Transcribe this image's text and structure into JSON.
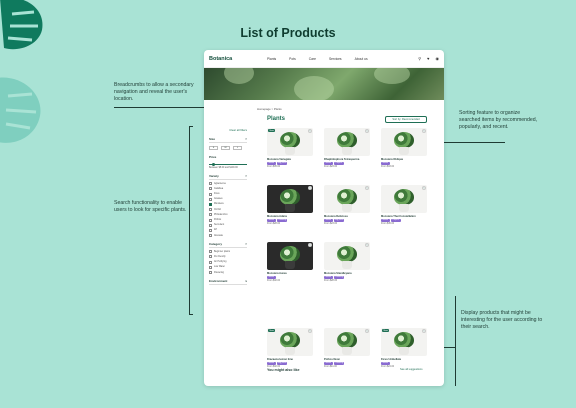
{
  "page_title": "List of Products",
  "annotations": {
    "breadcrumbs": "Breadcrumbs to allow a secondary navigation and reveal the user's location.",
    "search": "Search functionality to enable users to look for specific plants.",
    "sorting": "Sorting feature to organize searched items by recommended, popularly, and recent.",
    "display": "Display products that might be interesting for the user according to their search."
  },
  "navbar": {
    "logo": "Botanica",
    "menu": [
      "Plants",
      "Pots",
      "Care",
      "Services",
      "About us"
    ],
    "icons": [
      "search-icon",
      "heart-icon",
      "cart-icon"
    ]
  },
  "breadcrumb": {
    "home": "Homepage",
    "current": "Plants"
  },
  "main": {
    "title": "Plants",
    "sort_label": "Sort by: Recommended"
  },
  "sidebar": {
    "clear_label": "Clear all filters",
    "size": {
      "label": "Size",
      "options": [
        "S",
        "M",
        "L"
      ]
    },
    "price": {
      "label": "Price",
      "range": "Between $5.00 and $100.00"
    },
    "variety": {
      "label": "Variety",
      "items": [
        "Aglaonema",
        "Calathea",
        "Ficus",
        "Grasses",
        "Monstera",
        "Orchid",
        "Philodendron",
        "Pothos",
        "Succulent",
        "ZZ",
        "Alocasia"
      ],
      "checked": "Monstera"
    },
    "category": {
      "label": "Category",
      "items": [
        "Beginner plants",
        "Pet friendly",
        "Air Purifying",
        "Low Water",
        "Flowering"
      ]
    },
    "environment": {
      "label": "Environment"
    }
  },
  "products": [
    {
      "name": "Monstera Variegata",
      "tags": [
        "Indoor",
        "Big plant"
      ],
      "price": "From $35.00",
      "new": true,
      "dark": false
    },
    {
      "name": "Rhaphidophora Tetrasperma",
      "tags": [
        "Indoor",
        "Tropical"
      ],
      "price": "From $23.00",
      "new": false,
      "dark": false
    },
    {
      "name": "Monstera Obliqua",
      "tags": [
        "Indoor"
      ],
      "price": "From $33.00",
      "new": false,
      "dark": false
    },
    {
      "name": "Monstera Adans",
      "tags": [
        "Indoor",
        "Climbing"
      ],
      "price": "From $28.00",
      "new": false,
      "dark": true
    },
    {
      "name": "Monstera Deliciosa",
      "tags": [
        "Indoor",
        "Big plant"
      ],
      "price": "From $23.00",
      "new": false,
      "dark": false
    },
    {
      "name": "Monstera Thai Constellation",
      "tags": [
        "Indoor",
        "Tropical"
      ],
      "price": "From $45.00",
      "new": false,
      "dark": false
    },
    {
      "name": "Monstera Aurea",
      "tags": [
        "Indoor"
      ],
      "price": "From $32.00",
      "new": false,
      "dark": true
    },
    {
      "name": "Monstera Standleyana",
      "tags": [
        "Indoor",
        "Climbing"
      ],
      "price": "From $28.00",
      "new": false,
      "dark": false
    }
  ],
  "like_section": {
    "title": "You might also like",
    "see_all": "See all suggestions",
    "items": [
      {
        "name": "Dracaena lemon lime",
        "tags": [
          "Indoor",
          "Big plant"
        ],
        "price": "From $32.00",
        "new": true
      },
      {
        "name": "Pothos Neon",
        "tags": [
          "Indoor",
          "Climbing"
        ],
        "price": "From $11.00",
        "new": false
      },
      {
        "name": "Ficus Umbellata",
        "tags": [
          "Indoor"
        ],
        "price": "From $24.00",
        "new": true
      }
    ]
  },
  "colors": {
    "background": "#a9e3d5",
    "accent": "#1f6f55",
    "tag": "#8a6bd1"
  }
}
